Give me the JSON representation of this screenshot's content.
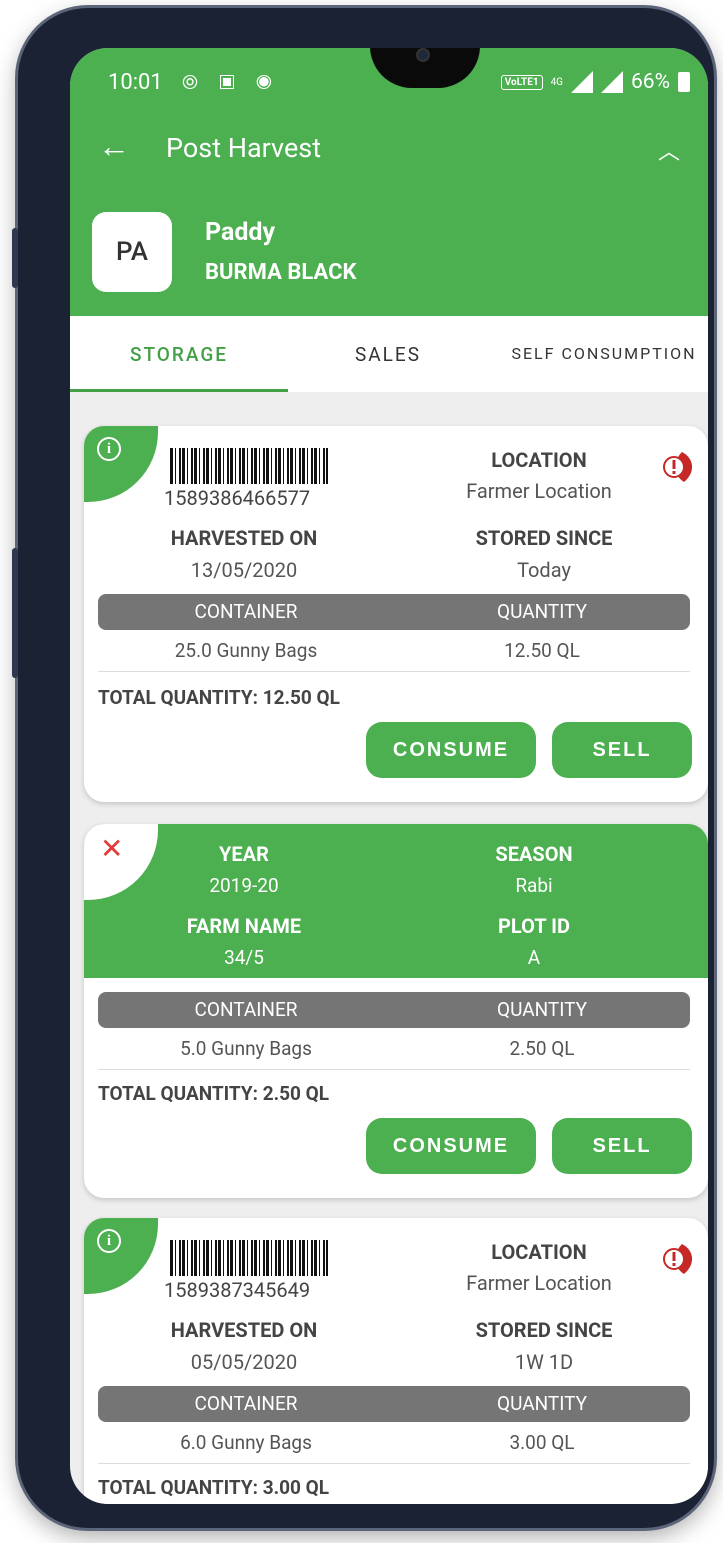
{
  "status_bar": {
    "time": "10:01",
    "left_icons": "⦾ ▣ ◉",
    "volte": "VoLTE1",
    "network": "4G",
    "battery": "66%"
  },
  "appbar": {
    "title": "Post Harvest"
  },
  "crop": {
    "initials": "PA",
    "name": "Paddy",
    "variety": "BURMA BLACK"
  },
  "tabs": [
    {
      "label": "STORAGE"
    },
    {
      "label": "SALES"
    },
    {
      "label": "SELF CONSUMPTION"
    }
  ],
  "labels": {
    "location": "LOCATION",
    "harvested_on": "HARVESTED ON",
    "stored_since": "STORED SINCE",
    "container": "CONTAINER",
    "quantity": "QUANTITY",
    "year": "YEAR",
    "season": "SEASON",
    "farm_name": "FARM NAME",
    "plot_id": "PLOT ID",
    "consume": "CONSUME",
    "sell": "SELL"
  },
  "cards": [
    {
      "barcode": "1589386466577",
      "location": "Farmer Location",
      "harvested_on": "13/05/2020",
      "stored_since": "Today",
      "container": "25.0 Gunny Bags",
      "quantity": "12.50 QL",
      "total": "TOTAL QUANTITY: 12.50 QL"
    },
    {
      "year": "2019-20",
      "season": "Rabi",
      "farm_name": "34/5",
      "plot_id": "A",
      "container": "5.0 Gunny Bags",
      "quantity": "2.50 QL",
      "total": "TOTAL QUANTITY: 2.50 QL"
    },
    {
      "barcode": "1589387345649",
      "location": "Farmer Location",
      "harvested_on": "05/05/2020",
      "stored_since": "1W 1D",
      "container": "6.0 Gunny Bags",
      "quantity": "3.00 QL",
      "total": "TOTAL QUANTITY: 3.00 QL"
    }
  ],
  "colors": {
    "primary": "#4caf50",
    "table_header": "#757575",
    "close": "#e53935",
    "alert_leaf": "#c62828"
  }
}
